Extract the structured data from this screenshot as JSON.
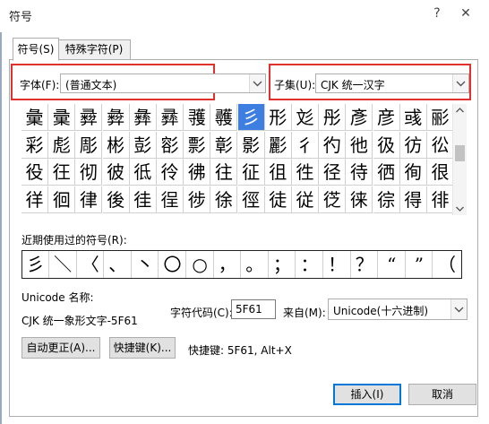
{
  "window": {
    "title": "符号",
    "help": "?",
    "close": "✕"
  },
  "tabs": [
    {
      "label": "符号(S)",
      "active": true
    },
    {
      "label": "特殊字符(P)",
      "active": false
    }
  ],
  "font": {
    "label": "字体(F):",
    "value": "(普通文本)"
  },
  "subset": {
    "label": "子集(U):",
    "value": "CJK 统一汉字"
  },
  "symbol_grid": {
    "rows": [
      [
        "彙",
        "彚",
        "彛",
        "彜",
        "彝",
        "彞",
        "彟",
        "彠",
        "彡",
        "形",
        "彣",
        "彤",
        "彥",
        "彦",
        "彧",
        "彨"
      ],
      [
        "彩",
        "彪",
        "彫",
        "彬",
        "彭",
        "彮",
        "彯",
        "彰",
        "影",
        "彲",
        "彳",
        "彴",
        "彵",
        "彶",
        "彷",
        "彸"
      ],
      [
        "役",
        "彺",
        "彻",
        "彼",
        "彽",
        "彾",
        "彿",
        "往",
        "征",
        "徂",
        "徃",
        "径",
        "待",
        "徆",
        "徇",
        "很"
      ],
      [
        "徉",
        "徊",
        "律",
        "後",
        "徍",
        "徎",
        "徏",
        "徐",
        "徑",
        "徒",
        "従",
        "徔",
        "徕",
        "徖",
        "得",
        "徘"
      ]
    ],
    "selected": {
      "row": 0,
      "col": 8
    }
  },
  "recent": {
    "label": "近期使用过的符号(R):",
    "symbols": [
      "彡",
      "＼",
      "〈",
      "、",
      "丶",
      "〇",
      "○",
      "，",
      "。",
      "；",
      "：",
      "！",
      "？",
      "“",
      "”",
      "（"
    ]
  },
  "unicode_name": {
    "label": "Unicode 名称:",
    "value": "CJK 统一象形文字-5F61"
  },
  "char_code": {
    "label": "字符代码(C):",
    "value": "5F61"
  },
  "from": {
    "label": "来自(M):",
    "value": "Unicode(十六进制)"
  },
  "buttons": {
    "autocorrect": "自动更正(A)...",
    "shortcut": "快捷键(K)...",
    "insert": "插入(I)",
    "cancel": "取消"
  },
  "shortcut_text": "快捷键: 5F61, Alt+X",
  "colors": {
    "highlight": "#e0312c",
    "selection": "#3d7ee0",
    "default_button_border": "#0078d7"
  }
}
